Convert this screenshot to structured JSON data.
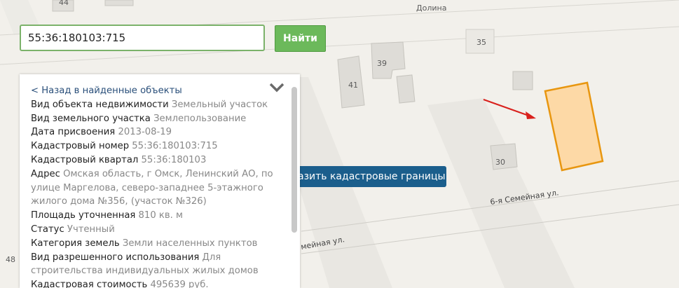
{
  "search": {
    "value": "55:36:180103:715",
    "button_label": "Найти"
  },
  "map": {
    "street_label_top": "Долина",
    "street_label_main": "6-я Семейная ул.",
    "street_label_lower": "мейная ул.",
    "house_numbers": {
      "h44": "44",
      "h35": "35",
      "h39": "39",
      "h41": "41",
      "h30": "30",
      "h48": "48"
    },
    "cadastral_button_label": "азить кадастровые границы",
    "parcel_color": "#fdd9a6",
    "parcel_border_color": "#e8960f",
    "arrow_color": "#d9201c"
  },
  "info": {
    "back_link": "< Назад в найденные объекты",
    "rows": [
      {
        "label": "Вид объекта недвижимости",
        "value": "Земельный участок"
      },
      {
        "label": "Вид земельного участка",
        "value": "Землепользование"
      },
      {
        "label": "Дата присвоения",
        "value": "2013-08-19"
      },
      {
        "label": "Кадастровый номер",
        "value": "55:36:180103:715"
      },
      {
        "label": "Кадастровый квартал",
        "value": "55:36:180103"
      },
      {
        "label": "Адрес",
        "value": "Омская область, г Омск, Ленинский АО, по улице Маргелова, северо-западнее 5-этажного жилого дома №356, (участок №326)"
      },
      {
        "label": "Площадь уточненная",
        "value": "810 кв. м"
      },
      {
        "label": "Статус",
        "value": "Учтенный"
      },
      {
        "label": "Категория земель",
        "value": "Земли населенных пунктов"
      },
      {
        "label": "Вид разрешенного использования",
        "value": "Для строительства индивидуальных жилых домов"
      },
      {
        "label": "Кадастровая стоимость",
        "value": "495639 руб."
      }
    ]
  }
}
